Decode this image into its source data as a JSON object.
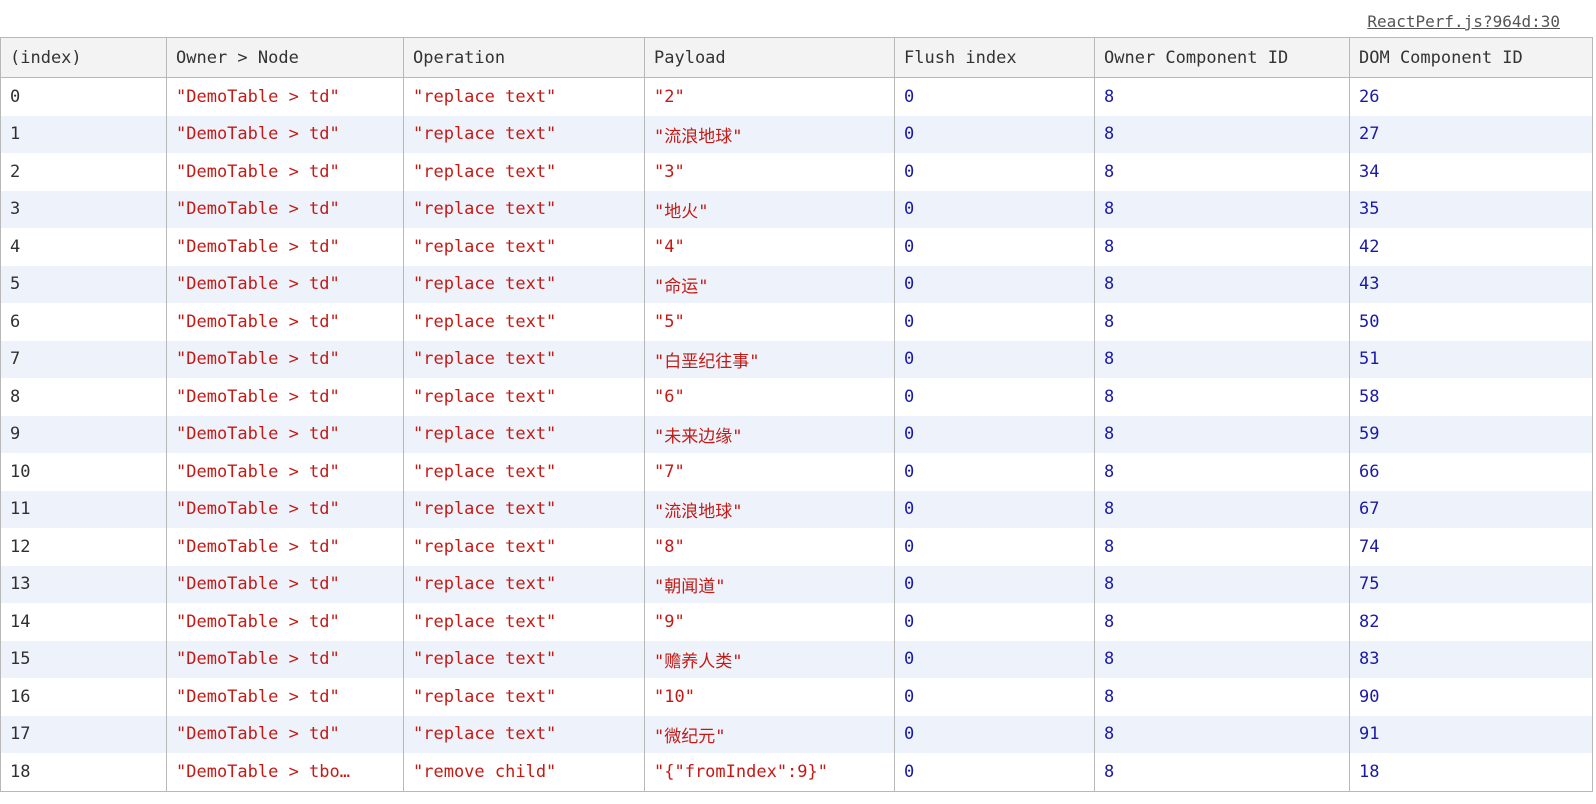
{
  "source_link": "ReactPerf.js?964d:30",
  "columns": [
    "(index)",
    "Owner > Node",
    "Operation",
    "Payload",
    "Flush index",
    "Owner Component ID",
    "DOM Component ID"
  ],
  "rows": [
    {
      "index": "0",
      "owner_node": "\"DemoTable > td\"",
      "operation": "\"replace text\"",
      "payload": "\"2\"",
      "flush_index": "0",
      "owner_component_id": "8",
      "dom_component_id": "26"
    },
    {
      "index": "1",
      "owner_node": "\"DemoTable > td\"",
      "operation": "\"replace text\"",
      "payload": "\"流浪地球\"",
      "flush_index": "0",
      "owner_component_id": "8",
      "dom_component_id": "27"
    },
    {
      "index": "2",
      "owner_node": "\"DemoTable > td\"",
      "operation": "\"replace text\"",
      "payload": "\"3\"",
      "flush_index": "0",
      "owner_component_id": "8",
      "dom_component_id": "34"
    },
    {
      "index": "3",
      "owner_node": "\"DemoTable > td\"",
      "operation": "\"replace text\"",
      "payload": "\"地火\"",
      "flush_index": "0",
      "owner_component_id": "8",
      "dom_component_id": "35"
    },
    {
      "index": "4",
      "owner_node": "\"DemoTable > td\"",
      "operation": "\"replace text\"",
      "payload": "\"4\"",
      "flush_index": "0",
      "owner_component_id": "8",
      "dom_component_id": "42"
    },
    {
      "index": "5",
      "owner_node": "\"DemoTable > td\"",
      "operation": "\"replace text\"",
      "payload": "\"命运\"",
      "flush_index": "0",
      "owner_component_id": "8",
      "dom_component_id": "43"
    },
    {
      "index": "6",
      "owner_node": "\"DemoTable > td\"",
      "operation": "\"replace text\"",
      "payload": "\"5\"",
      "flush_index": "0",
      "owner_component_id": "8",
      "dom_component_id": "50"
    },
    {
      "index": "7",
      "owner_node": "\"DemoTable > td\"",
      "operation": "\"replace text\"",
      "payload": "\"白垩纪往事\"",
      "flush_index": "0",
      "owner_component_id": "8",
      "dom_component_id": "51"
    },
    {
      "index": "8",
      "owner_node": "\"DemoTable > td\"",
      "operation": "\"replace text\"",
      "payload": "\"6\"",
      "flush_index": "0",
      "owner_component_id": "8",
      "dom_component_id": "58"
    },
    {
      "index": "9",
      "owner_node": "\"DemoTable > td\"",
      "operation": "\"replace text\"",
      "payload": "\"未来边缘\"",
      "flush_index": "0",
      "owner_component_id": "8",
      "dom_component_id": "59"
    },
    {
      "index": "10",
      "owner_node": "\"DemoTable > td\"",
      "operation": "\"replace text\"",
      "payload": "\"7\"",
      "flush_index": "0",
      "owner_component_id": "8",
      "dom_component_id": "66"
    },
    {
      "index": "11",
      "owner_node": "\"DemoTable > td\"",
      "operation": "\"replace text\"",
      "payload": "\"流浪地球\"",
      "flush_index": "0",
      "owner_component_id": "8",
      "dom_component_id": "67"
    },
    {
      "index": "12",
      "owner_node": "\"DemoTable > td\"",
      "operation": "\"replace text\"",
      "payload": "\"8\"",
      "flush_index": "0",
      "owner_component_id": "8",
      "dom_component_id": "74"
    },
    {
      "index": "13",
      "owner_node": "\"DemoTable > td\"",
      "operation": "\"replace text\"",
      "payload": "\"朝闻道\"",
      "flush_index": "0",
      "owner_component_id": "8",
      "dom_component_id": "75"
    },
    {
      "index": "14",
      "owner_node": "\"DemoTable > td\"",
      "operation": "\"replace text\"",
      "payload": "\"9\"",
      "flush_index": "0",
      "owner_component_id": "8",
      "dom_component_id": "82"
    },
    {
      "index": "15",
      "owner_node": "\"DemoTable > td\"",
      "operation": "\"replace text\"",
      "payload": "\"赡养人类\"",
      "flush_index": "0",
      "owner_component_id": "8",
      "dom_component_id": "83"
    },
    {
      "index": "16",
      "owner_node": "\"DemoTable > td\"",
      "operation": "\"replace text\"",
      "payload": "\"10\"",
      "flush_index": "0",
      "owner_component_id": "8",
      "dom_component_id": "90"
    },
    {
      "index": "17",
      "owner_node": "\"DemoTable > td\"",
      "operation": "\"replace text\"",
      "payload": "\"微纪元\"",
      "flush_index": "0",
      "owner_component_id": "8",
      "dom_component_id": "91"
    },
    {
      "index": "18",
      "owner_node": "\"DemoTable > tbo…",
      "operation": "\"remove child\"",
      "payload": "\"{\"fromIndex\":9}\"",
      "flush_index": "0",
      "owner_component_id": "8",
      "dom_component_id": "18"
    }
  ],
  "colors": {
    "string": "#c41a16",
    "number": "#1a1aa6",
    "index": "#303030",
    "row_stripe": "#eef3fb",
    "header_bg": "#f3f3f3",
    "grid": "#b8b8b8"
  }
}
